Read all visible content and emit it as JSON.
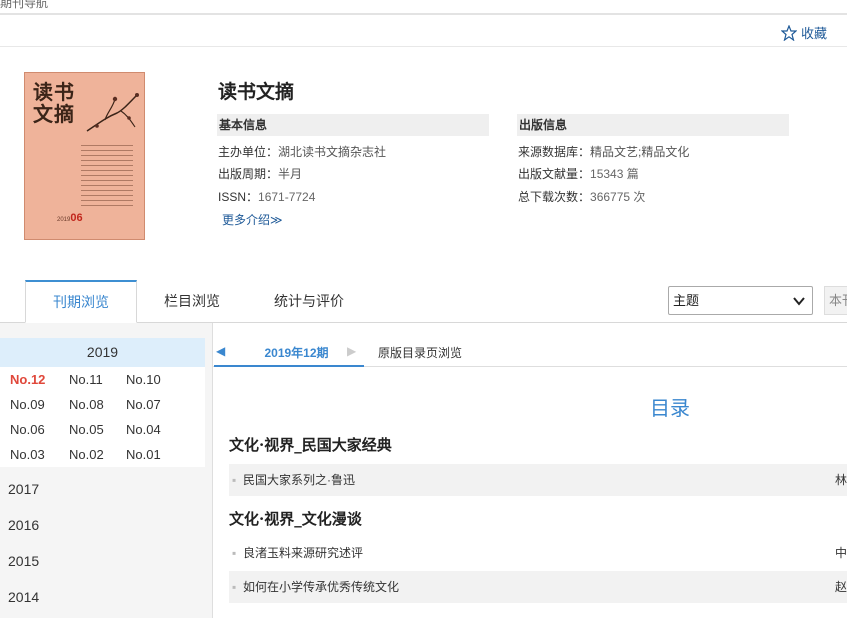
{
  "top": {
    "crumb": "期刊导航",
    "favorite_label": "收藏"
  },
  "journal": {
    "title": "读书文摘",
    "cover": {
      "title_text": "读书文摘",
      "issue_text": "06",
      "year_text": "2019"
    },
    "basic_info": {
      "heading": "基本信息",
      "rows": [
        {
          "label": "主办单位：",
          "value": "湖北读书文摘杂志社"
        },
        {
          "label": "出版周期：",
          "value": "半月"
        },
        {
          "label": "ISSN：",
          "value": "1671-7724"
        }
      ],
      "more_label": "更多介绍≫"
    },
    "publish_info": {
      "heading": "出版信息",
      "rows": [
        {
          "label": "来源数据库：",
          "value": "精品文艺;精品文化"
        },
        {
          "label": "出版文献量：",
          "value": "15343 篇"
        },
        {
          "label": "总下载次数：",
          "value": "366775 次"
        }
      ]
    }
  },
  "tabs": [
    {
      "label": "刊期浏览",
      "active": true
    },
    {
      "label": "栏目浏览",
      "active": false
    },
    {
      "label": "统计与评价",
      "active": false
    }
  ],
  "search": {
    "select_value": "主题",
    "side_label": "本刊"
  },
  "years": {
    "active_year": "2019",
    "issues": [
      "No.12",
      "No.11",
      "No.10",
      "No.09",
      "No.08",
      "No.07",
      "No.06",
      "No.05",
      "No.04",
      "No.03",
      "No.02",
      "No.01"
    ],
    "current_issue": "No.12",
    "other_years": [
      "2017",
      "2016",
      "2015",
      "2014"
    ]
  },
  "content": {
    "subtab_active": "2019年12期",
    "subtab_other": "原版目录页浏览",
    "toc_title": "目录",
    "sections": [
      {
        "name": "文化·视界_民国大家经典",
        "articles": [
          {
            "title": "民国大家系列之·鲁迅",
            "tail": "林"
          }
        ]
      },
      {
        "name": "文化·视界_文化漫谈",
        "articles": [
          {
            "title": "良渚玉料来源研究述评",
            "tail": "中"
          },
          {
            "title": "如何在小学传承优秀传统文化",
            "tail": "赵"
          }
        ]
      }
    ]
  },
  "colors": {
    "accent": "#3a87cf",
    "current_issue": "#e0473a",
    "cover_bg": "#efb39a"
  }
}
